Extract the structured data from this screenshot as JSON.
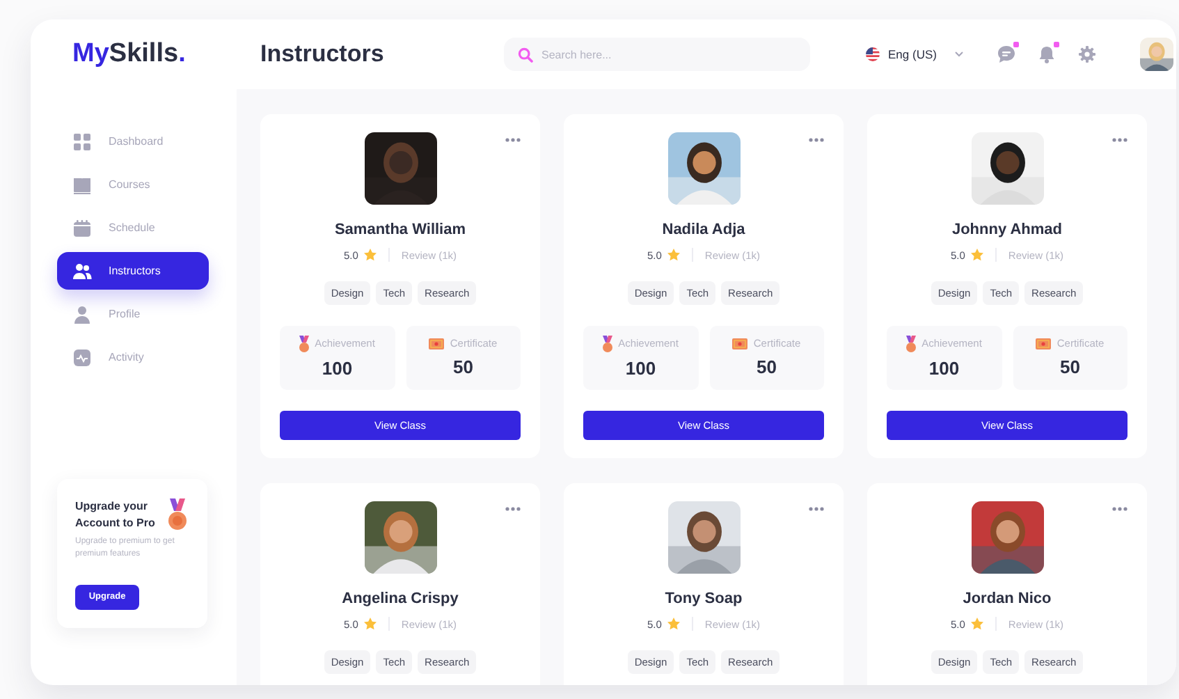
{
  "logo": [
    {
      "text": "My",
      "accent": true
    },
    {
      "text": "Skills",
      "accent": false
    },
    {
      "text": ".",
      "accent": true
    }
  ],
  "page_title": "Instructors",
  "search": {
    "placeholder": "Search here..."
  },
  "language": {
    "label": "Eng (US)"
  },
  "header_icons": [
    {
      "kind": "chat",
      "unread": true
    },
    {
      "kind": "bell",
      "unread": true
    },
    {
      "kind": "settings",
      "unread": false
    }
  ],
  "sidebar": {
    "items": [
      {
        "kind": "dashboard",
        "label": "Dashboard",
        "selected": false
      },
      {
        "kind": "courses",
        "label": "Courses",
        "selected": false
      },
      {
        "kind": "schedule",
        "label": "Schedule",
        "selected": false
      },
      {
        "kind": "instructors",
        "label": "Instructors",
        "selected": true
      },
      {
        "kind": "profile",
        "label": "Profile",
        "selected": false
      },
      {
        "kind": "activity",
        "label": "Activity",
        "selected": false
      }
    ]
  },
  "upgrade_card": {
    "title": "Upgrade your Account to Pro",
    "text": "Upgrade to premium to get premium features",
    "button": "Upgrade"
  },
  "instructors": [
    {
      "name": "Samantha William",
      "rating": "5.0",
      "review": "Review (1k)",
      "tags": [
        "Design",
        "Tech",
        "Research"
      ],
      "stats": [
        {
          "kind": "achievement",
          "label": "Achievement",
          "value": "100"
        },
        {
          "kind": "certificate",
          "label": "Certificate",
          "value": "50"
        }
      ],
      "button": "View Class"
    },
    {
      "name": "Nadila Adja",
      "rating": "5.0",
      "review": "Review (1k)",
      "tags": [
        "Design",
        "Tech",
        "Research"
      ],
      "stats": [
        {
          "kind": "achievement",
          "label": "Achievement",
          "value": "100"
        },
        {
          "kind": "certificate",
          "label": "Certificate",
          "value": "50"
        }
      ],
      "button": "View Class"
    },
    {
      "name": "Johnny Ahmad",
      "rating": "5.0",
      "review": "Review (1k)",
      "tags": [
        "Design",
        "Tech",
        "Research"
      ],
      "stats": [
        {
          "kind": "achievement",
          "label": "Achievement",
          "value": "100"
        },
        {
          "kind": "certificate",
          "label": "Certificate",
          "value": "50"
        }
      ],
      "button": "View Class"
    },
    {
      "name": "Angelina Crispy",
      "rating": "5.0",
      "review": "Review (1k)",
      "tags": [
        "Design",
        "Tech",
        "Research"
      ]
    },
    {
      "name": "Tony Soap",
      "rating": "5.0",
      "review": "Review (1k)",
      "tags": [
        "Design",
        "Tech",
        "Research"
      ]
    },
    {
      "name": "Jordan Nico",
      "rating": "5.0",
      "review": "Review (1k)",
      "tags": [
        "Design",
        "Tech",
        "Research"
      ]
    }
  ]
}
